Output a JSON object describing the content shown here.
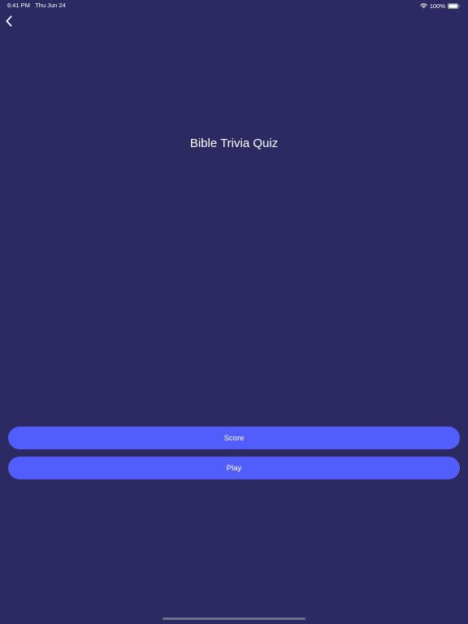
{
  "status_bar": {
    "time": "6:41 PM",
    "date": "Thu Jun 24",
    "battery": "100%"
  },
  "icons": {
    "back": "chevron-left-icon",
    "wifi": "wifi-icon",
    "battery": "battery-icon"
  },
  "main": {
    "title": "Bible Trivia Quiz",
    "score_label": "Score",
    "play_label": "Play"
  },
  "colors": {
    "background": "#2d2a63",
    "button": "#525efb",
    "text": "#ffffff"
  }
}
